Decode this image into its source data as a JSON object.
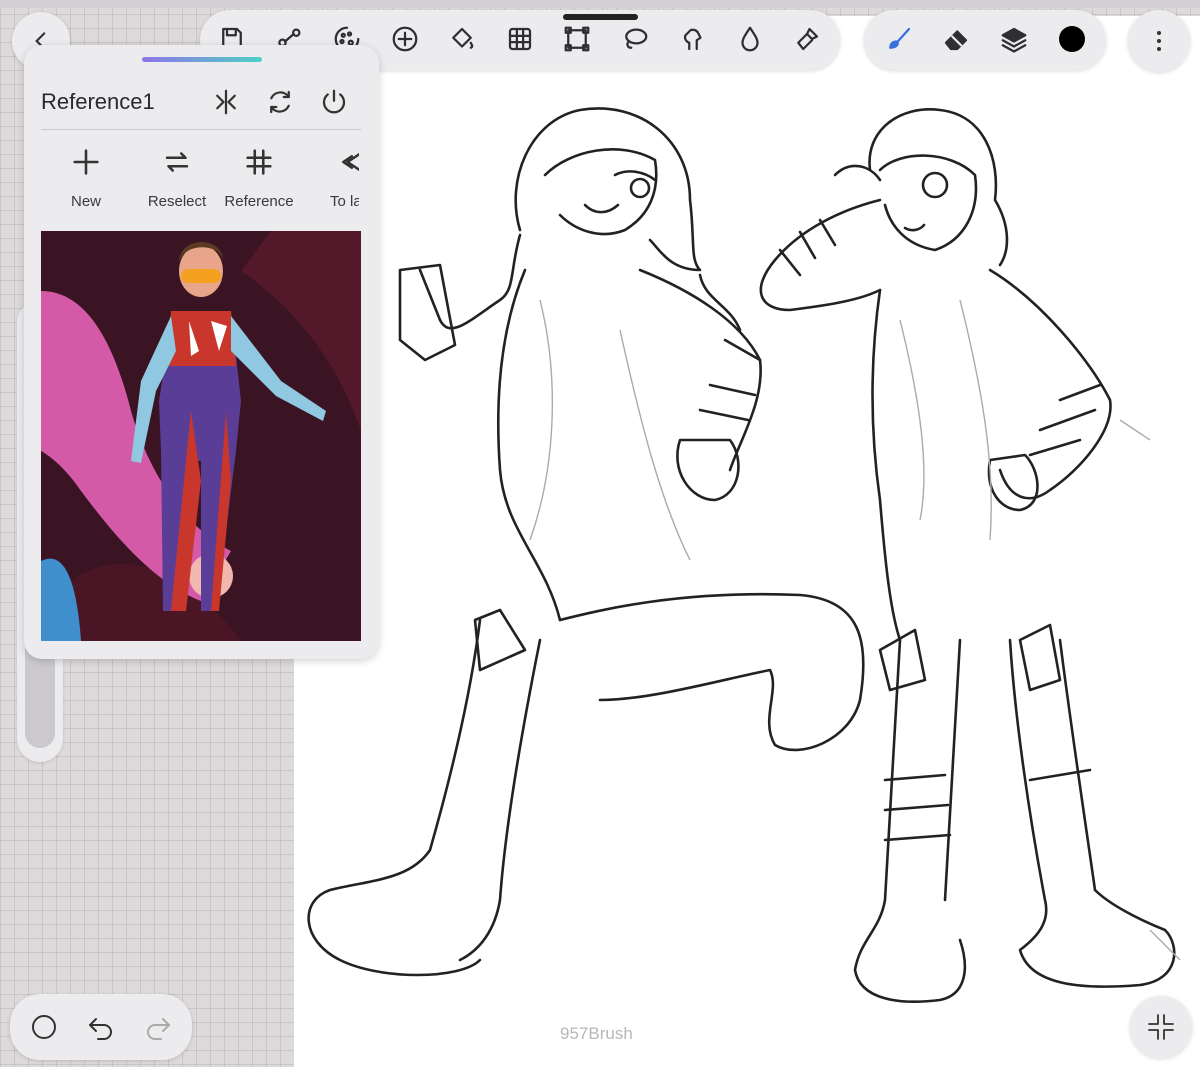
{
  "toolbar": {
    "tools": [
      {
        "name": "save",
        "icon": "save-icon"
      },
      {
        "name": "share",
        "icon": "share-icon"
      },
      {
        "name": "adjustments",
        "icon": "adjustments-icon"
      },
      {
        "name": "add",
        "icon": "add-icon"
      },
      {
        "name": "fill",
        "icon": "fill-bucket-icon"
      },
      {
        "name": "grid",
        "icon": "grid-icon"
      },
      {
        "name": "transform",
        "icon": "transform-icon"
      },
      {
        "name": "lasso",
        "icon": "lasso-icon"
      },
      {
        "name": "liquify",
        "icon": "liquify-icon"
      },
      {
        "name": "blur",
        "icon": "water-drop-icon"
      },
      {
        "name": "smudge",
        "icon": "smudge-brush-icon"
      }
    ],
    "drawing_tools": [
      {
        "name": "brush",
        "icon": "brush-icon",
        "active": true,
        "color": "#3b6fe0"
      },
      {
        "name": "eraser",
        "icon": "eraser-icon"
      },
      {
        "name": "layers",
        "icon": "layers-icon"
      },
      {
        "name": "color",
        "icon": "color-swatch",
        "color": "#000000"
      }
    ],
    "more_icon": "more-vertical-icon",
    "back_icon": "chevron-left-icon"
  },
  "reference_panel": {
    "title": "Reference1",
    "header_icons": [
      "flip-icon",
      "refresh-icon",
      "power-icon"
    ],
    "actions": [
      {
        "label": "New",
        "icon": "plus-icon"
      },
      {
        "label": "Reselect",
        "icon": "reselect-icon"
      },
      {
        "label": "Reference",
        "icon": "hash-icon"
      },
      {
        "label": "To la",
        "icon": "layer-icon"
      }
    ],
    "accent_colors": [
      "#8f74e8",
      "#4fd0c6"
    ]
  },
  "bottom_bar": {
    "icons": [
      "circle-icon",
      "undo-icon",
      "redo-icon"
    ]
  },
  "watermark": "957Brush",
  "colors": {
    "background": "#dedadc",
    "panel": "#ecebee",
    "canvas": "#ffffff"
  }
}
